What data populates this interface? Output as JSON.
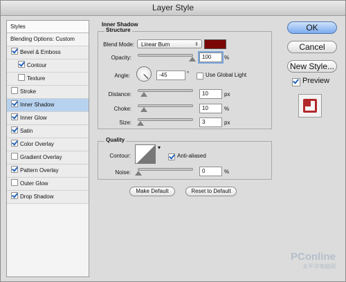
{
  "window": {
    "title": "Layer Style"
  },
  "styles_panel": {
    "header": "Styles",
    "blending": "Blending Options: Custom",
    "items": [
      {
        "label": "Bevel & Emboss",
        "checked": true
      },
      {
        "label": "Contour",
        "checked": true
      },
      {
        "label": "Texture",
        "checked": false
      },
      {
        "label": "Stroke",
        "checked": false
      },
      {
        "label": "Inner Shadow",
        "checked": true
      },
      {
        "label": "Inner Glow",
        "checked": true
      },
      {
        "label": "Satin",
        "checked": true
      },
      {
        "label": "Color Overlay",
        "checked": true
      },
      {
        "label": "Gradient Overlay",
        "checked": false
      },
      {
        "label": "Pattern Overlay",
        "checked": true
      },
      {
        "label": "Outer Glow",
        "checked": false
      },
      {
        "label": "Drop Shadow",
        "checked": true
      }
    ]
  },
  "inner_shadow": {
    "title": "Inner Shadow",
    "structure": {
      "title": "Structure",
      "blend_mode_label": "Blend Mode:",
      "blend_mode_value": "Linear Burn",
      "shadow_color": "#7a0606",
      "opacity_label": "Opacity:",
      "opacity_value": "100",
      "opacity_unit": "%",
      "angle_label": "Angle:",
      "angle_value": "-45",
      "angle_unit": "°",
      "global_light_label": "Use Global Light",
      "global_light_checked": false,
      "distance_label": "Distance:",
      "distance_value": "10",
      "distance_unit": "px",
      "choke_label": "Choke:",
      "choke_value": "10",
      "choke_unit": "%",
      "size_label": "Size:",
      "size_value": "3",
      "size_unit": "px"
    },
    "quality": {
      "title": "Quality",
      "contour_label": "Contour:",
      "anti_aliased_label": "Anti-aliased",
      "anti_aliased_checked": true,
      "noise_label": "Noise:",
      "noise_value": "0",
      "noise_unit": "%"
    },
    "make_default": "Make Default",
    "reset_default": "Reset to Default"
  },
  "actions": {
    "ok": "OK",
    "cancel": "Cancel",
    "new_style": "New Style...",
    "preview_label": "Preview",
    "preview_checked": true
  },
  "watermark": {
    "brand": "PConline",
    "subtitle": "太平洋电脑网"
  }
}
